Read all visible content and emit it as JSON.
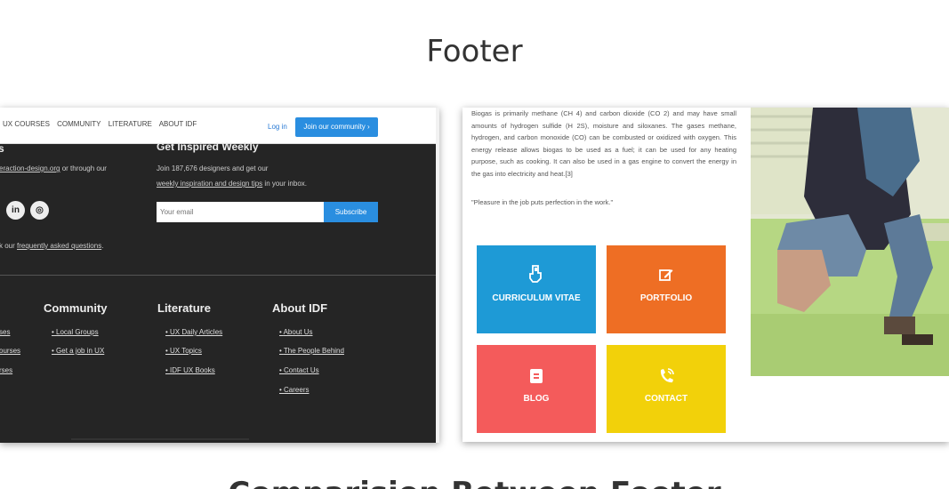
{
  "page": {
    "section_title": "Footer",
    "bottom_title": "Comparision Between Footer"
  },
  "left_card": {
    "nav": [
      "UX COURSES",
      "COMMUNITY",
      "LITERATURE",
      "ABOUT IDF"
    ],
    "login": "Log in",
    "join_button": "Join our community ›",
    "left_heading": "s",
    "left_line1_link": "eraction-design.org",
    "left_line1_rest": " or through our",
    "social": [
      "in",
      "◎"
    ],
    "faq_prefix": "k our ",
    "faq_link": "frequently asked questions",
    "faq_suffix": ".",
    "inspired_heading": "Get Inspired Weekly",
    "join_text": "Join 187,676 designers and get our",
    "tips_link": "weekly inspiration and design tips",
    "tips_suffix": " in your inbox.",
    "email_placeholder": "Your email",
    "subscribe": "Subscribe",
    "columns": {
      "col0": {
        "links": [
          "ses",
          "ourses",
          "rses"
        ]
      },
      "community": {
        "heading": "Community",
        "links": [
          "Local Groups",
          "Get a job in UX"
        ]
      },
      "literature": {
        "heading": "Literature",
        "links": [
          "UX Daily Articles",
          "UX Topics",
          "IDF UX Books"
        ]
      },
      "about": {
        "heading": "About IDF",
        "links": [
          "About Us",
          "The People Behind",
          "Contact Us",
          "Careers"
        ]
      }
    }
  },
  "right_card": {
    "paragraph": "Biogas is primarily methane (CH 4) and carbon dioxide (CO 2) and may have small amounts of hydrogen sulfide (H 2S), moisture and siloxanes. The gases methane, hydrogen, and carbon monoxide (CO) can be combusted or oxidized with oxygen. This energy release allows biogas to be used as a fuel; it can be used for any heating purpose, such as cooking. It can also be used in a gas engine to convert the energy in the gas into electricity and heat.[3]",
    "quote": "\"Pleasure in the job puts perfection in the work.\"",
    "tiles": [
      {
        "label": "CURRICULUM VITAE",
        "icon": "hand-pointer-icon",
        "color": "#1e9ad6"
      },
      {
        "label": "PORTFOLIO",
        "icon": "edit-icon",
        "color": "#ee6e24"
      },
      {
        "label": "BLOG",
        "icon": "blog-icon",
        "color": "#f45b5b"
      },
      {
        "label": "CONTACT",
        "icon": "phone-icon",
        "color": "#f2d10a"
      }
    ]
  }
}
